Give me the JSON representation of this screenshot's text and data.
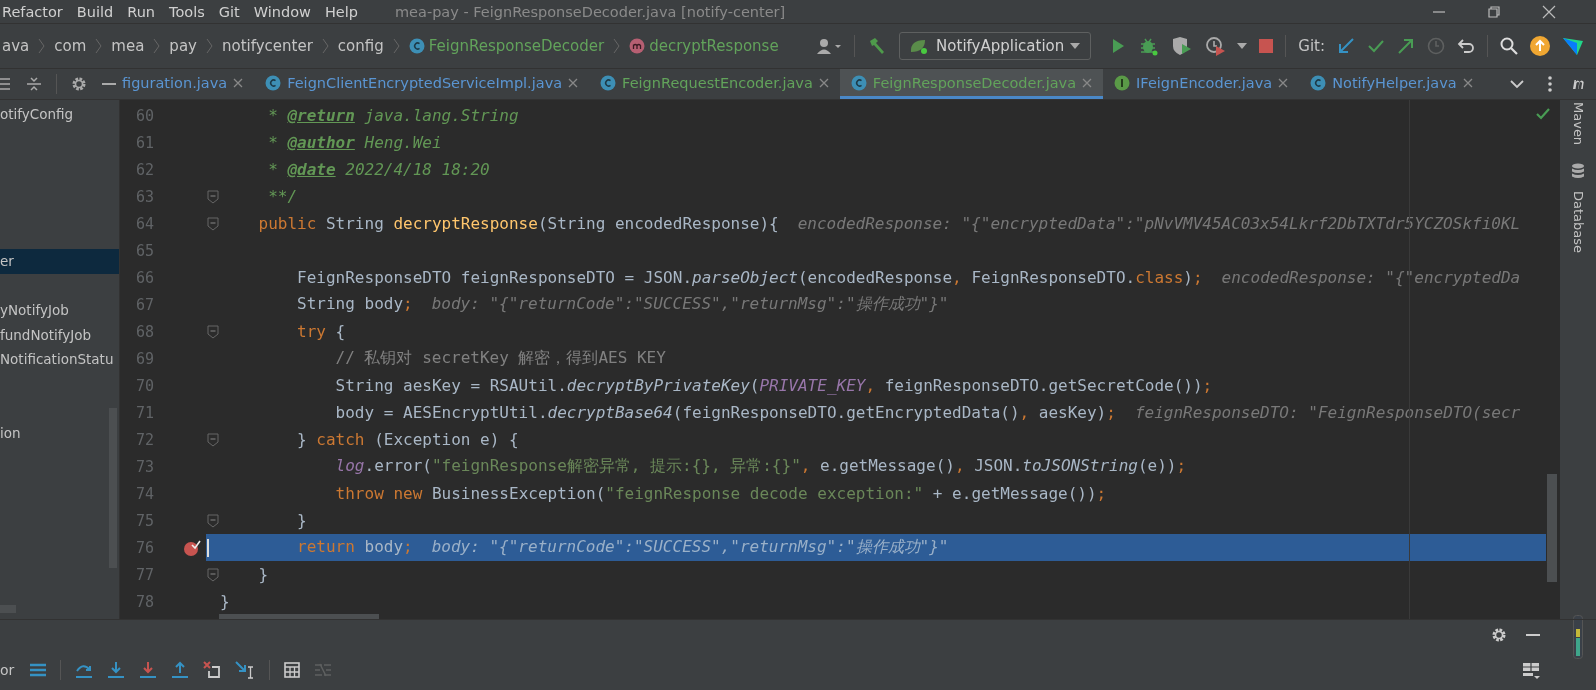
{
  "menu": [
    "Refactor",
    "Build",
    "Run",
    "Tools",
    "Git",
    "Window",
    "Help"
  ],
  "window": {
    "title": "mea-pay - FeignResponseDecoder.java [notify-center]"
  },
  "breadcrumbs": [
    {
      "label": "ava",
      "kind": "package"
    },
    {
      "label": "com",
      "kind": "package"
    },
    {
      "label": "mea",
      "kind": "package"
    },
    {
      "label": "pay",
      "kind": "package"
    },
    {
      "label": "notifycenter",
      "kind": "package"
    },
    {
      "label": "config",
      "kind": "package"
    },
    {
      "label": "FeignResponseDecoder",
      "kind": "class"
    },
    {
      "label": "decryptResponse",
      "kind": "method"
    }
  ],
  "run_config": {
    "label": "NotifyApplication"
  },
  "git_label": "Git:",
  "project_tree": [
    {
      "label": "otifyConfig",
      "selected": false
    },
    {
      "label": "er",
      "selected": true
    },
    {
      "label": "yNotifyJob",
      "selected": false
    },
    {
      "label": "fundNotifyJob",
      "selected": false
    },
    {
      "label": "NotificationStatu",
      "selected": false
    },
    {
      "label": "ion",
      "selected": false
    }
  ],
  "tabs": [
    {
      "label": "figuration.java",
      "kind": "none",
      "color": "#5a95d2",
      "selected": false
    },
    {
      "label": "FeignClientEncryptedServiceImpl.java",
      "kind": "class",
      "color": "#5a95d2",
      "selected": false
    },
    {
      "label": "FeignRequestEncoder.java",
      "kind": "class",
      "color": "#62a35b",
      "selected": false
    },
    {
      "label": "FeignResponseDecoder.java",
      "kind": "class",
      "color": "#62a35b",
      "selected": true
    },
    {
      "label": "IFeignEncoder.java",
      "kind": "interface",
      "color": "#5a95d2",
      "selected": false
    },
    {
      "label": "NotifyHelper.java",
      "kind": "class",
      "color": "#5a95d2",
      "selected": false
    }
  ],
  "tool_windows": [
    "Maven",
    "Database"
  ],
  "debug_label": "or",
  "code": [
    {
      "number": "60",
      "tokens": [
        {
          "kind": "doc",
          "s": "     * "
        },
        {
          "kind": "doctag",
          "s": "@return"
        },
        {
          "kind": "doc",
          "s": " java.lang.String"
        }
      ]
    },
    {
      "number": "61",
      "tokens": [
        {
          "kind": "doc",
          "s": "     * "
        },
        {
          "kind": "doctag",
          "s": "@author"
        },
        {
          "kind": "doc",
          "s": " Heng.Wei"
        }
      ]
    },
    {
      "number": "62",
      "tokens": [
        {
          "kind": "doc",
          "s": "     * "
        },
        {
          "kind": "doctag",
          "s": "@date"
        },
        {
          "kind": "doc",
          "s": " 2022/4/18 18:20"
        }
      ]
    },
    {
      "number": "63",
      "fold": true,
      "tokens": [
        {
          "kind": "doc",
          "s": "     **/"
        }
      ]
    },
    {
      "number": "64",
      "fold": true,
      "tokens": [
        {
          "kind": "kw",
          "s": "    public"
        },
        {
          "kind": "plain",
          "s": " String "
        },
        {
          "kind": "fn",
          "s": "decryptResponse"
        },
        {
          "kind": "plain",
          "s": "(String encodedResponse){"
        },
        {
          "kind": "hint",
          "s": "encodedResponse: \"{\"encryptedData\":\"pNvVMV45AC03x54Lkrf2DbTXTdr5YCZOSkfi0KL"
        }
      ]
    },
    {
      "number": "65"
    },
    {
      "number": "66",
      "tokens": [
        {
          "kind": "plain",
          "s": "        FeignResponseDTO feignResponseDTO = JSON."
        },
        {
          "kind": "static",
          "s": "parseObject"
        },
        {
          "kind": "plain",
          "s": "(encodedResponse"
        },
        {
          "kind": "kw",
          "s": ","
        },
        {
          "kind": "plain",
          "s": " FeignResponseDTO."
        },
        {
          "kind": "kw",
          "s": "class"
        },
        {
          "kind": "plain",
          "s": ")"
        },
        {
          "kind": "kw",
          "s": ";"
        },
        {
          "kind": "hint",
          "s": "encodedResponse: \"{\"encryptedDa"
        }
      ]
    },
    {
      "number": "67",
      "tokens": [
        {
          "kind": "plain",
          "s": "        String body"
        },
        {
          "kind": "kw",
          "s": ";"
        },
        {
          "kind": "hint",
          "s": "body: \"{\"returnCode\":\"SUCCESS\",\"returnMsg\":\"操作成功\"}\""
        }
      ]
    },
    {
      "number": "68",
      "fold": true,
      "tokens": [
        {
          "kind": "kw",
          "s": "        try"
        },
        {
          "kind": "plain",
          "s": " {"
        }
      ]
    },
    {
      "number": "69",
      "tokens": [
        {
          "kind": "comment",
          "s": "            // 私钥对 secretKey 解密，得到AES KEY"
        }
      ]
    },
    {
      "number": "70",
      "tokens": [
        {
          "kind": "plain",
          "s": "            String aesKey = RSAUtil."
        },
        {
          "kind": "static",
          "s": "decryptByPrivateKey"
        },
        {
          "kind": "plain",
          "s": "("
        },
        {
          "kind": "const",
          "s": "PRIVATE_KEY"
        },
        {
          "kind": "kw",
          "s": ","
        },
        {
          "kind": "plain",
          "s": " feignResponseDTO.getSecretCode())"
        },
        {
          "kind": "kw",
          "s": ";"
        }
      ]
    },
    {
      "number": "71",
      "tokens": [
        {
          "kind": "plain",
          "s": "            body = AESEncryptUtil."
        },
        {
          "kind": "static",
          "s": "decryptBase64"
        },
        {
          "kind": "plain",
          "s": "(feignResponseDTO.getEncryptedData()"
        },
        {
          "kind": "kw",
          "s": ","
        },
        {
          "kind": "plain",
          "s": " aesKey)"
        },
        {
          "kind": "kw",
          "s": ";"
        },
        {
          "kind": "hint",
          "s": "feignResponseDTO: \"FeignResponseDTO(secr"
        }
      ]
    },
    {
      "number": "72",
      "fold": true,
      "tokens": [
        {
          "kind": "plain",
          "s": "        } "
        },
        {
          "kind": "kw",
          "s": "catch"
        },
        {
          "kind": "plain",
          "s": " (Exception e) {"
        }
      ]
    },
    {
      "number": "73",
      "tokens": [
        {
          "kind": "const",
          "s": "            log"
        },
        {
          "kind": "plain",
          "s": ".error("
        },
        {
          "kind": "str",
          "s": "\"feignResponse解密异常, 提示:{}, 异常:{}\""
        },
        {
          "kind": "kw",
          "s": ","
        },
        {
          "kind": "plain",
          "s": " e.getMessage()"
        },
        {
          "kind": "kw",
          "s": ","
        },
        {
          "kind": "plain",
          "s": " JSON."
        },
        {
          "kind": "static",
          "s": "toJSONString"
        },
        {
          "kind": "plain",
          "s": "(e))"
        },
        {
          "kind": "kw",
          "s": ";"
        }
      ]
    },
    {
      "number": "74",
      "tokens": [
        {
          "kind": "kw",
          "s": "            throw new"
        },
        {
          "kind": "plain",
          "s": " BusinessException("
        },
        {
          "kind": "str",
          "s": "\"feignResponse decode exception:\""
        },
        {
          "kind": "plain",
          "s": " + e.getMessage())"
        },
        {
          "kind": "kw",
          "s": ";"
        }
      ]
    },
    {
      "number": "75",
      "fold": true,
      "tokens": [
        {
          "kind": "plain",
          "s": "        }"
        }
      ]
    },
    {
      "number": "76",
      "breakpoint": true,
      "current": true,
      "tokens": [
        {
          "kind": "kw",
          "s": "        return"
        },
        {
          "kind": "plain",
          "s": " body"
        },
        {
          "kind": "kw",
          "s": ";"
        },
        {
          "kind": "hint",
          "s": "body: \"{\"returnCode\":\"SUCCESS\",\"returnMsg\":\"操作成功\"}\""
        }
      ]
    },
    {
      "number": "77",
      "fold": true,
      "tokens": [
        {
          "kind": "plain",
          "s": "    }"
        }
      ]
    },
    {
      "number": "78",
      "tokens": [
        {
          "kind": "plain",
          "s": "}"
        }
      ]
    }
  ]
}
